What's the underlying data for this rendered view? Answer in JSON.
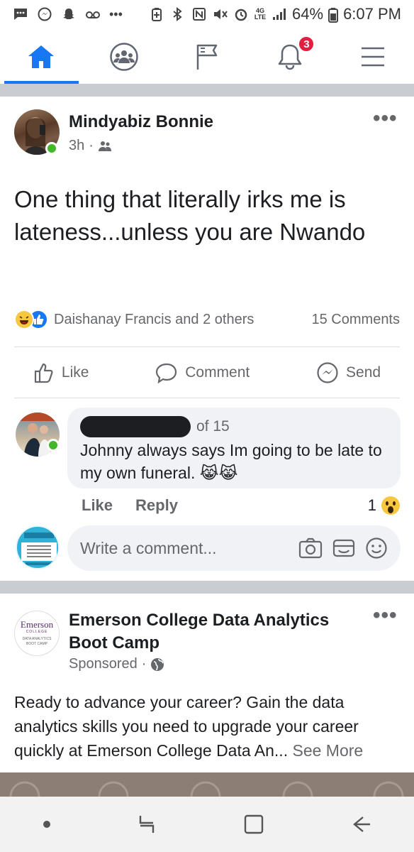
{
  "status_bar": {
    "battery": "64%",
    "time": "6:07 PM",
    "network": "4G LTE",
    "left_icons": [
      "message-icon",
      "messenger-icon",
      "snapchat-icon",
      "voicemail-icon",
      "more-icon"
    ],
    "right_icons": [
      "battery-saver-icon",
      "bluetooth-icon",
      "nfc-icon",
      "mute-icon",
      "alarm-icon",
      "signal-icon",
      "battery-icon"
    ]
  },
  "nav": {
    "tabs": [
      {
        "name": "home",
        "icon": "home-icon",
        "active": true
      },
      {
        "name": "groups",
        "icon": "groups-icon",
        "active": false
      },
      {
        "name": "pages",
        "icon": "flag-icon",
        "active": false
      },
      {
        "name": "notifications",
        "icon": "bell-icon",
        "active": false,
        "badge": "3"
      },
      {
        "name": "menu",
        "icon": "hamburger-icon",
        "active": false
      }
    ],
    "active_color": "#1877f2"
  },
  "post": {
    "author": "Mindyabiz Bonnie",
    "time": "3h",
    "privacy_icon": "friends-icon",
    "more": "•••",
    "text": "One thing that literally irks me is lateness...unless you are Nwando",
    "reactions_text": "Daishanay Francis and 2 others",
    "reaction_icons": [
      "haha-icon",
      "like-icon"
    ],
    "comments_count": "15 Comments",
    "actions": [
      {
        "label": "Like",
        "icon": "thumbs-up-icon"
      },
      {
        "label": "Comment",
        "icon": "comment-icon"
      },
      {
        "label": "Send",
        "icon": "messenger-icon"
      }
    ]
  },
  "comment": {
    "position_text": "of 15",
    "text": "Johnny always says Im going to be late to my own funeral. 😹😹",
    "like_label": "Like",
    "reply_label": "Reply",
    "reaction_count": "1",
    "reaction_icon": "wow-icon"
  },
  "write_comment": {
    "placeholder": "Write a comment...",
    "icons": [
      "camera-icon",
      "gif-icon",
      "emoji-icon"
    ],
    "avatar_text": "Knowledge is Power: Politics & the Housing Crisis · Wednesday June 23rd"
  },
  "sponsored_post": {
    "author": "Emerson College Data Analytics Boot Camp",
    "meta": "Sponsored",
    "more": "•••",
    "logo_line1": "Emerson",
    "logo_line2": "COLLEGE",
    "logo_line3": "DATA ANALYTICS",
    "logo_line4": "BOOT CAMP",
    "text": "Ready to advance your career? Gain the data analytics skills you need to upgrade your career quickly at Emerson College Data An...",
    "see_more": "See More"
  },
  "colors": {
    "accent": "#1877f2",
    "badge": "#e41e3f",
    "online": "#42b72a",
    "divider": "#c9ccd1",
    "muted_text": "#65676b"
  }
}
